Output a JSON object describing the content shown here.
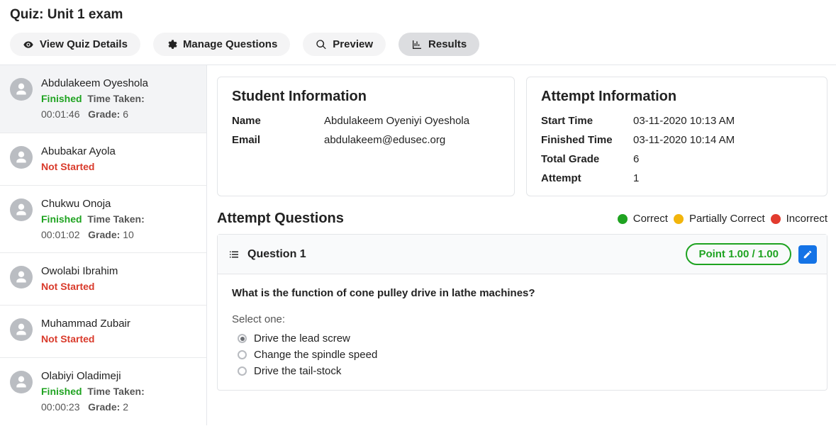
{
  "page_title": "Quiz: Unit 1 exam",
  "tabs": {
    "view_details": "View Quiz Details",
    "manage_questions": "Manage Questions",
    "preview": "Preview",
    "results": "Results"
  },
  "students": [
    {
      "name": "Abdulakeem Oyeshola",
      "status": "Finished",
      "time_label": "Time Taken:",
      "time": "00:01:46",
      "grade_label": "Grade:",
      "grade": "6"
    },
    {
      "name": "Abubakar Ayola",
      "status": "Not Started"
    },
    {
      "name": "Chukwu Onoja",
      "status": "Finished",
      "time_label": "Time Taken:",
      "time": "00:01:02",
      "grade_label": "Grade:",
      "grade": "10"
    },
    {
      "name": "Owolabi Ibrahim",
      "status": "Not Started"
    },
    {
      "name": "Muhammad Zubair",
      "status": "Not Started"
    },
    {
      "name": "Olabiyi Oladimeji",
      "status": "Finished",
      "time_label": "Time Taken:",
      "time": "00:00:23",
      "grade_label": "Grade:",
      "grade": "2"
    }
  ],
  "student_info": {
    "title": "Student Information",
    "name_label": "Name",
    "name_value": "Abdulakeem Oyeniyi Oyeshola",
    "email_label": "Email",
    "email_value": "abdulakeem@edusec.org"
  },
  "attempt_info": {
    "title": "Attempt Information",
    "start_label": "Start Time",
    "start_value": "03-11-2020 10:13 AM",
    "finish_label": "Finished Time",
    "finish_value": "03-11-2020 10:14 AM",
    "grade_label": "Total Grade",
    "grade_value": "6",
    "attempt_label": "Attempt",
    "attempt_value": "1"
  },
  "questions_section": {
    "title": "Attempt Questions",
    "legend_correct": "Correct",
    "legend_partial": "Partially Correct",
    "legend_incorrect": "Incorrect"
  },
  "question": {
    "label": "Question 1",
    "point_badge": "Point 1.00 / 1.00",
    "text": "What is the function of cone pulley drive in lathe machines?",
    "select_one": "Select one:",
    "options": [
      {
        "text": "Drive the lead screw",
        "checked": true
      },
      {
        "text": "Change the spindle speed",
        "checked": false
      },
      {
        "text": "Drive the tail-stock",
        "checked": false
      }
    ]
  }
}
